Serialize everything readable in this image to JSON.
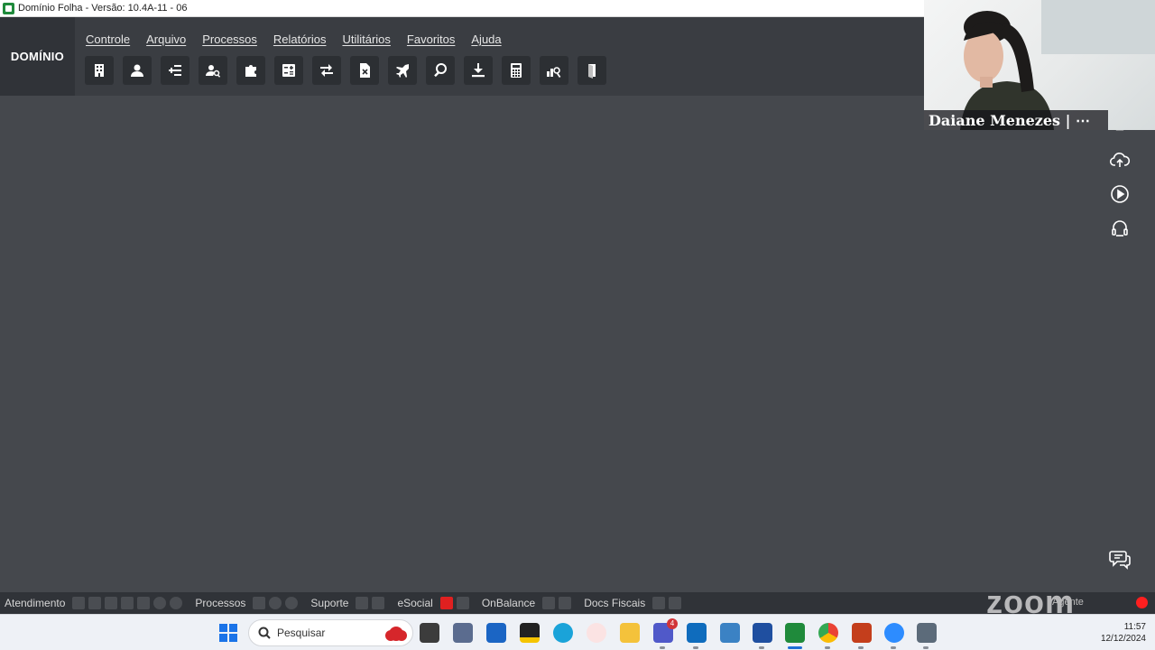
{
  "window": {
    "title": "Domínio Folha - Versão: 10.4A-11 - 06"
  },
  "header": {
    "brand": "DOMÍNIO",
    "menu": [
      {
        "label": "Controle"
      },
      {
        "label": "Arquivo"
      },
      {
        "label": "Processos"
      },
      {
        "label": "Relatórios"
      },
      {
        "label": "Utilitários"
      },
      {
        "label": "Favoritos"
      },
      {
        "label": "Ajuda"
      }
    ],
    "toolbar_icons": [
      "building-icon",
      "employee-icon",
      "add-list-icon",
      "user-search-icon",
      "puzzle-icon",
      "calculator-sheet-icon",
      "transfer-icon",
      "close-document-icon",
      "airplane-icon",
      "search-icon",
      "download-icon",
      "calculator-icon",
      "chart-search-icon",
      "exit-door-icon"
    ]
  },
  "right_rail": {
    "icons": [
      "cloud-upload-icon",
      "play-icon",
      "support-agent-icon"
    ],
    "chat_icon": "chat-bubbles-icon"
  },
  "video_overlay": {
    "participant_name": "Daiane Menezes | ⋯"
  },
  "statusbar": {
    "sections": [
      {
        "label": "Atendimento"
      },
      {
        "label": "Processos"
      },
      {
        "label": "Suporte"
      },
      {
        "label": "eSocial"
      },
      {
        "label": "OnBalance"
      },
      {
        "label": "Docs Fiscais"
      }
    ],
    "zoom_logo": "zoom",
    "agent_label": "Agente"
  },
  "taskbar": {
    "search_placeholder": "Pesquisar",
    "teams_badge": "4",
    "time": "11:57",
    "date": "12/12/2024"
  },
  "colors": {
    "workspace": "#45484d",
    "header": "#3a3d42",
    "brand_panel": "#303338",
    "record": "#ff1f1f"
  }
}
